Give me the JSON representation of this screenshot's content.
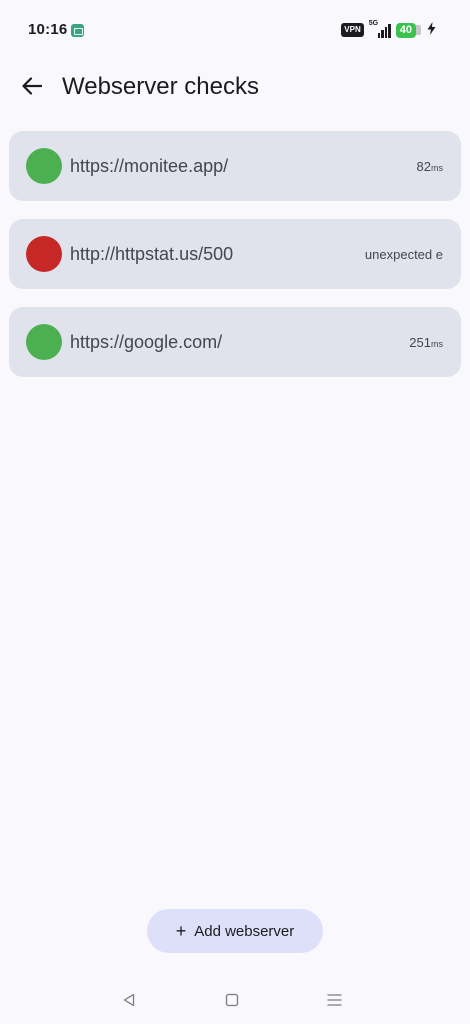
{
  "status_bar": {
    "time": "10:16",
    "vpn_label": "VPN",
    "network_type": "5G",
    "battery_level": "40",
    "battery_color": "#3bc24e",
    "icons": [
      "notification-icon",
      "signal-icon",
      "battery-icon",
      "charging-icon"
    ]
  },
  "app_bar": {
    "title": "Webserver checks",
    "back_icon": "arrow-left-icon"
  },
  "servers": [
    {
      "url": "https://monitee.app/",
      "result_value": "82",
      "result_unit": "ms",
      "status": "ok",
      "status_color": "#4cb050"
    },
    {
      "url": "http://httpstat.us/500",
      "result_value": "unexpected e",
      "result_unit": "",
      "status": "error",
      "status_color": "#c62828"
    },
    {
      "url": "https://google.com/",
      "result_value": "251",
      "result_unit": "ms",
      "status": "ok",
      "status_color": "#4cb050"
    }
  ],
  "fab": {
    "icon": "plus-icon",
    "plus_glyph": "+",
    "label": "Add webserver"
  },
  "nav_bar": {
    "icons": [
      "back-triangle-icon",
      "home-square-icon",
      "menu-icon"
    ]
  }
}
